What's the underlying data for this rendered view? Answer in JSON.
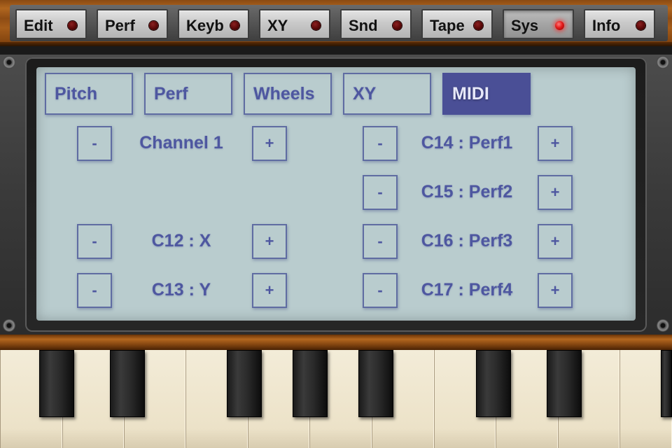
{
  "menu": {
    "items": [
      {
        "label": "Edit",
        "active": false
      },
      {
        "label": "Perf",
        "active": false
      },
      {
        "label": "Keyb",
        "active": false
      },
      {
        "label": "XY",
        "active": false
      },
      {
        "label": "Snd",
        "active": false
      },
      {
        "label": "Tape",
        "active": false
      },
      {
        "label": "Sys",
        "active": true
      },
      {
        "label": "Info",
        "active": false
      }
    ]
  },
  "screen": {
    "tabs": [
      {
        "label": "Pitch",
        "selected": false
      },
      {
        "label": "Perf",
        "selected": false
      },
      {
        "label": "Wheels",
        "selected": false
      },
      {
        "label": "XY",
        "selected": false
      },
      {
        "label": "MIDI",
        "selected": true
      }
    ],
    "controls": {
      "minus_glyph": "-",
      "plus_glyph": "+"
    },
    "midi": {
      "channel": "Channel 1",
      "cc_x": "C12 : X",
      "cc_y": "C13 : Y",
      "cc_perf1": "C14 : Perf1",
      "cc_perf2": "C15 : Perf2",
      "cc_perf3": "C16 : Perf3",
      "cc_perf4": "C17 : Perf4"
    }
  },
  "colors": {
    "lcd_background": "#b9ccce",
    "lcd_text": "#4e57a0",
    "tab_selected": "#4a4f96",
    "led_on": "#e41a1a"
  },
  "icons": {
    "led": "led-indicator-icon"
  }
}
